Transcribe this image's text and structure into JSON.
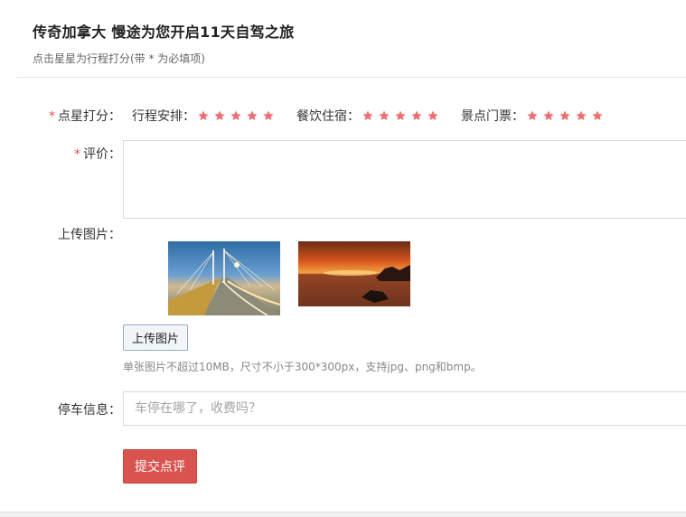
{
  "header": {
    "title": "传奇加拿大 慢途为您开启11天自驾之旅",
    "subtitle": "点击星星为行程打分(带 * 为必填项)"
  },
  "form": {
    "required_mark": "*",
    "rating": {
      "label": "点星打分：",
      "categories": [
        {
          "label": "行程安排：",
          "stars": 5
        },
        {
          "label": "餐饮住宿：",
          "stars": 5
        },
        {
          "label": "景点门票：",
          "stars": 5
        }
      ],
      "star_color": "#ef6f6f"
    },
    "review": {
      "label": "评价：",
      "value": ""
    },
    "upload": {
      "label": "上传图片：",
      "button_label": "上传图片",
      "note": "单张图片不超过10MB，尺寸不小于300*300px，支持jpg、png和bmp。"
    },
    "parking": {
      "label": "停车信息：",
      "placeholder": "车停在哪了，收费吗？"
    },
    "submit_label": "提交点评"
  },
  "colors": {
    "accent": "#d9534f",
    "required": "#e84d5b"
  }
}
